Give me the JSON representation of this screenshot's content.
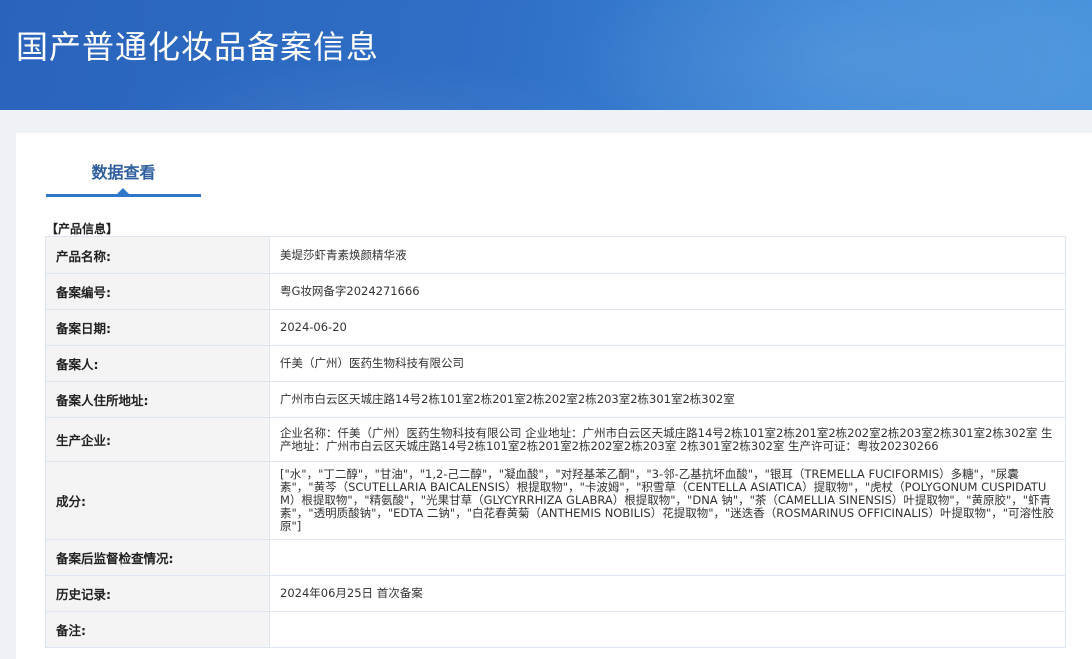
{
  "header": {
    "title": "国产普通化妆品备案信息"
  },
  "tabs": [
    {
      "label": "数据查看",
      "active": true
    }
  ],
  "section": {
    "title": "【产品信息】"
  },
  "colors": {
    "banner": "#2f6fc6",
    "accent": "#2f78c9",
    "tab_text": "#2f5f9e",
    "label_bg": "#f4f4f4"
  },
  "rows": [
    {
      "label": "产品名称:",
      "value": "美堤莎虾青素焕颜精华液"
    },
    {
      "label": "备案编号:",
      "value": "粤G妆网备字2024271666"
    },
    {
      "label": "备案日期:",
      "value": "2024-06-20"
    },
    {
      "label": "备案人:",
      "value": "仟美（广州）医药生物科技有限公司"
    },
    {
      "label": "备案人住所地址:",
      "value": "广州市白云区天城庄路14号2栋101室2栋201室2栋202室2栋203室2栋301室2栋302室"
    },
    {
      "label": "生产企业:",
      "value": "企业名称：仟美（广州）医药生物科技有限公司 企业地址：广州市白云区天城庄路14号2栋101室2栋201室2栋202室2栋203室2栋301室2栋302室 生产地址：广州市白云区天城庄路14号2栋101室2栋201室2栋202室2栋203室 2栋301室2栋302室 生产许可证：粤妆20230266"
    },
    {
      "label": "成分:",
      "value": "[\"水\"，\"丁二醇\"，\"甘油\"，\"1,2-己二醇\"，\"凝血酸\"，\"对羟基苯乙酮\"，\"3-邻-乙基抗坏血酸\"，\"银耳（TREMELLA FUCIFORMIS）多糖\"，\"尿囊素\"，\"黄芩（SCUTELLARIA BAICALENSIS）根提取物\"，\"卡波姆\"，\"积雪草（CENTELLA ASIATICA）提取物\"，\"虎杖（POLYGONUM CUSPIDATUM）根提取物\"，\"精氨酸\"，\"光果甘草（GLYCYRRHIZA GLABRA）根提取物\"，\"DNA 钠\"，\"茶（CAMELLIA SINENSIS）叶提取物\"，\"黄原胶\"，\"虾青素\"，\"透明质酸钠\"，\"EDTA 二钠\"，\"白花春黄菊（ANTHEMIS NOBILIS）花提取物\"，\"迷迭香（ROSMARINUS OFFICINALIS）叶提取物\"，\"可溶性胶原\"]"
    },
    {
      "label": "备案后监督检查情况:",
      "value": ""
    },
    {
      "label": "历史记录:",
      "value": "2024年06月25日 首次备案"
    },
    {
      "label": "备注:",
      "value": ""
    }
  ]
}
